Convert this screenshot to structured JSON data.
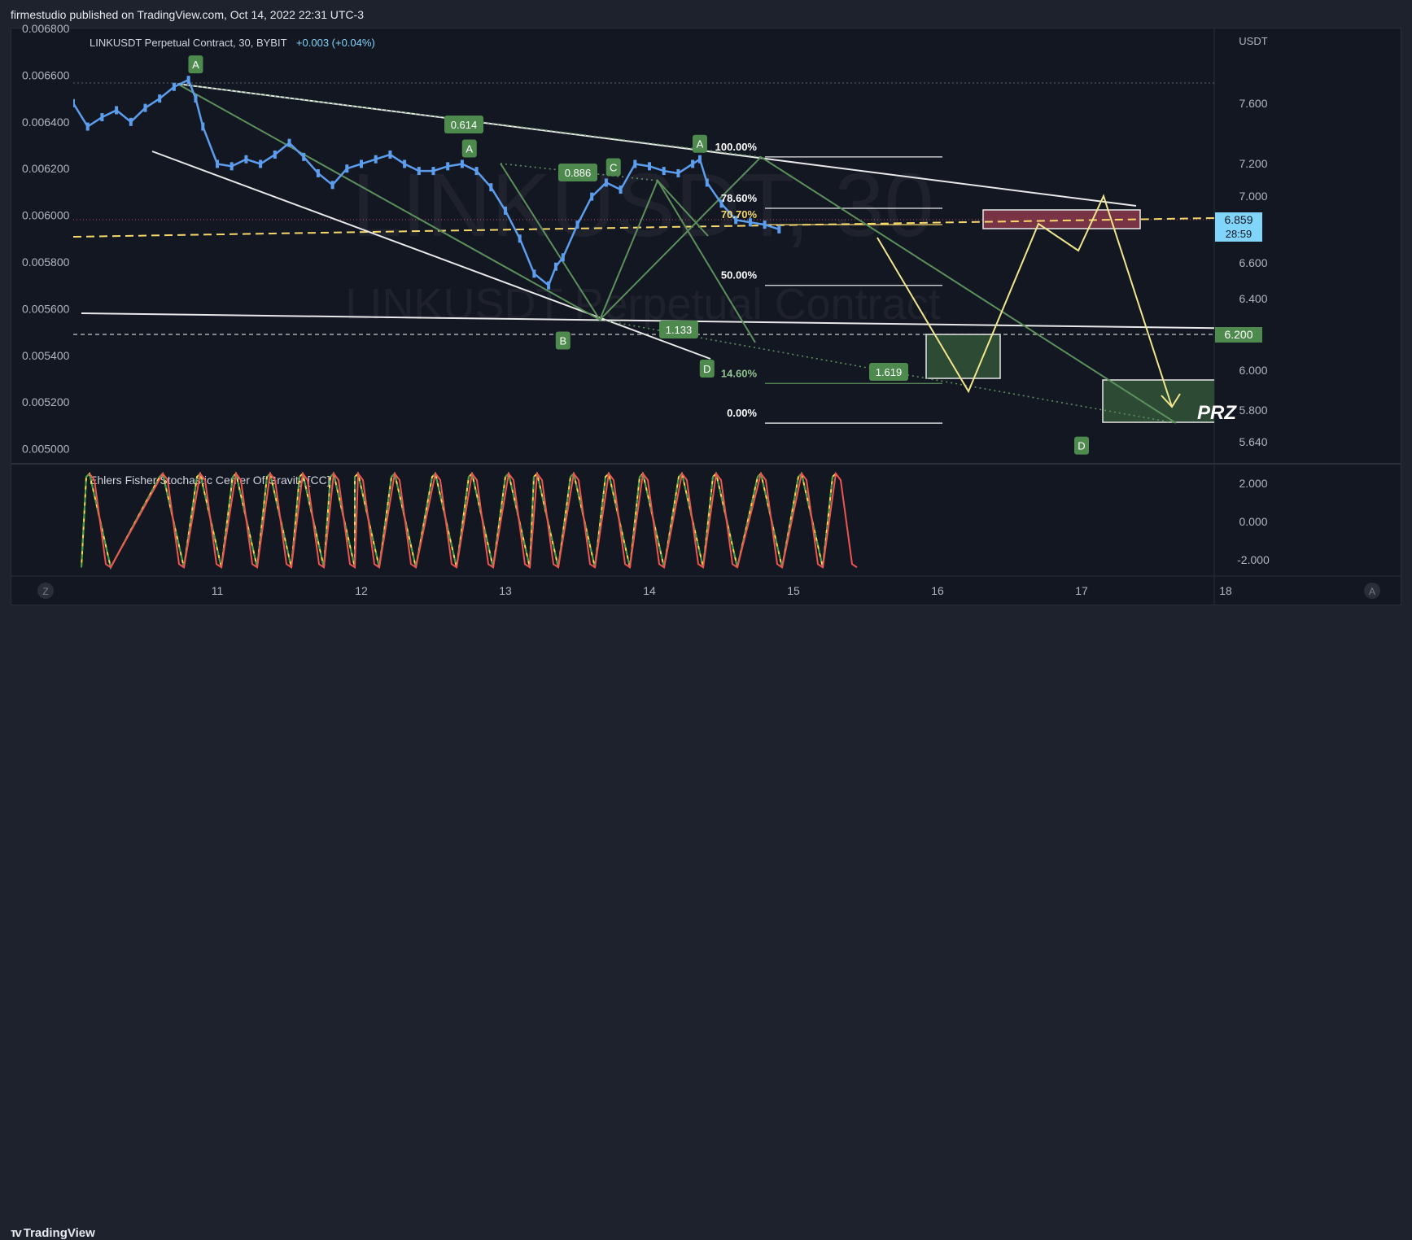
{
  "header": {
    "published_by": "firmestudio published on TradingView.com, Oct 14, 2022 22:31 UTC-3"
  },
  "legend": {
    "symbol": "LINKUSDT Perpetual Contract, 30, BYBIT",
    "change": "+0.003 (+0.04%)"
  },
  "watermark": {
    "big": "LINKUSDT, 30",
    "small": "LINKUSDT Perpetual Contract"
  },
  "indicator": {
    "name": "Ehlers Fisher Stochastic Center Of Gravity [CC]"
  },
  "footer": {
    "logo": "TradingView",
    "zoom_left": "Z",
    "auto_right": "A"
  },
  "colors": {
    "background": "#131722",
    "candle_up": "#5d9ded",
    "harmonic_green": "#5d8f5d",
    "label_green": "#4e8a4e",
    "trendline": "#e8e8e8",
    "projection": "#f0e68c",
    "fib_yellow": "#f5d76e",
    "red_zone": "#8b3a4a",
    "prz_green": "#2d4a35",
    "osc_green": "#43a047",
    "osc_red": "#ef5350",
    "osc_yellow": "#f4e04d",
    "last_price_tag": "#81d4fa"
  },
  "chart_data": {
    "type": "line",
    "title": "LINKUSDT Perpetual Contract, 30, BYBIT",
    "x_ticks": [
      "11",
      "12",
      "13",
      "14",
      "15",
      "16",
      "17",
      "18"
    ],
    "left_axis": {
      "ticks": [
        "0.006800",
        "0.006600",
        "0.006400",
        "0.006200",
        "0.006000",
        "0.005800",
        "0.005600",
        "0.005400",
        "0.005200",
        "0.005000"
      ],
      "ylim": [
        0.00495,
        0.0068
      ]
    },
    "right_axis": {
      "unit": "USDT",
      "ticks": [
        "7.600",
        "7.200",
        "7.000",
        "6.600",
        "6.400",
        "6.000",
        "5.800",
        "5.640"
      ],
      "tags": [
        {
          "text": "6.859",
          "sub": "28:59"
        },
        {
          "text": "6.200"
        }
      ]
    },
    "price_series": {
      "name": "LINKUSDT",
      "x": [
        10.0,
        10.1,
        10.2,
        10.3,
        10.4,
        10.5,
        10.6,
        10.7,
        10.8,
        10.85,
        10.9,
        11.0,
        11.1,
        11.2,
        11.3,
        11.4,
        11.5,
        11.6,
        11.7,
        11.8,
        11.9,
        12.0,
        12.1,
        12.2,
        12.3,
        12.4,
        12.5,
        12.6,
        12.7,
        12.8,
        12.9,
        13.0,
        13.1,
        13.2,
        13.3,
        13.35,
        13.4,
        13.5,
        13.6,
        13.7,
        13.8,
        13.9,
        14.0,
        14.1,
        14.2,
        14.3,
        14.35,
        14.4,
        14.5,
        14.6,
        14.7,
        14.8,
        14.9
      ],
      "y": [
        0.00648,
        0.00638,
        0.00642,
        0.00645,
        0.0064,
        0.00646,
        0.0065,
        0.00655,
        0.00658,
        0.0065,
        0.00638,
        0.00622,
        0.00621,
        0.00624,
        0.00622,
        0.00626,
        0.00631,
        0.00625,
        0.00618,
        0.00613,
        0.0062,
        0.00622,
        0.00624,
        0.00626,
        0.00622,
        0.00619,
        0.00619,
        0.00621,
        0.00622,
        0.00619,
        0.00612,
        0.00602,
        0.0059,
        0.00575,
        0.0057,
        0.00578,
        0.00582,
        0.00596,
        0.00608,
        0.00614,
        0.00611,
        0.00622,
        0.00621,
        0.00619,
        0.00618,
        0.00622,
        0.00624,
        0.00614,
        0.00605,
        0.00598,
        0.00597,
        0.00596,
        0.00594
      ]
    },
    "harmonic_points": [
      {
        "label": "A",
        "x": 10.85,
        "y": 0.00658
      },
      {
        "label": "B",
        "x": 13.4,
        "y": 0.00553
      },
      {
        "label": "A",
        "x": 12.75,
        "y": 0.00622
      },
      {
        "label": "C",
        "x": 13.75,
        "y": 0.00614
      },
      {
        "label": "A",
        "x": 14.35,
        "y": 0.00624
      },
      {
        "label": "D",
        "x": 14.4,
        "y": 0.00541
      },
      {
        "label": "D",
        "x": 17.0,
        "y": 0.00508
      }
    ],
    "ratios": [
      "0.614",
      "0.886",
      "1.133",
      "1.619"
    ],
    "fib_levels": [
      {
        "label": "100.00%",
        "y": 0.00625
      },
      {
        "label": "78.60%",
        "y": 0.00603
      },
      {
        "label": "70.70%",
        "y": 0.00596
      },
      {
        "label": "50.00%",
        "y": 0.0057
      },
      {
        "label": "14.60%",
        "y": 0.00528
      },
      {
        "label": "0.00%",
        "y": 0.00511
      }
    ],
    "zones": [
      {
        "label": "",
        "y_top": 0.00601,
        "y_bottom": 0.00594
      },
      {
        "label": "",
        "y_top": 0.00548,
        "y_bottom": 0.00528
      },
      {
        "label": "PRZ",
        "y_top": 0.00534,
        "y_bottom": 0.00511
      }
    ],
    "oscillator": {
      "name": "Ehlers Fisher Stochastic Center Of Gravity [CC]",
      "ticks": [
        "2.000",
        "0.000",
        "-2.000"
      ],
      "ylim": [
        -2.6,
        2.8
      ]
    }
  }
}
